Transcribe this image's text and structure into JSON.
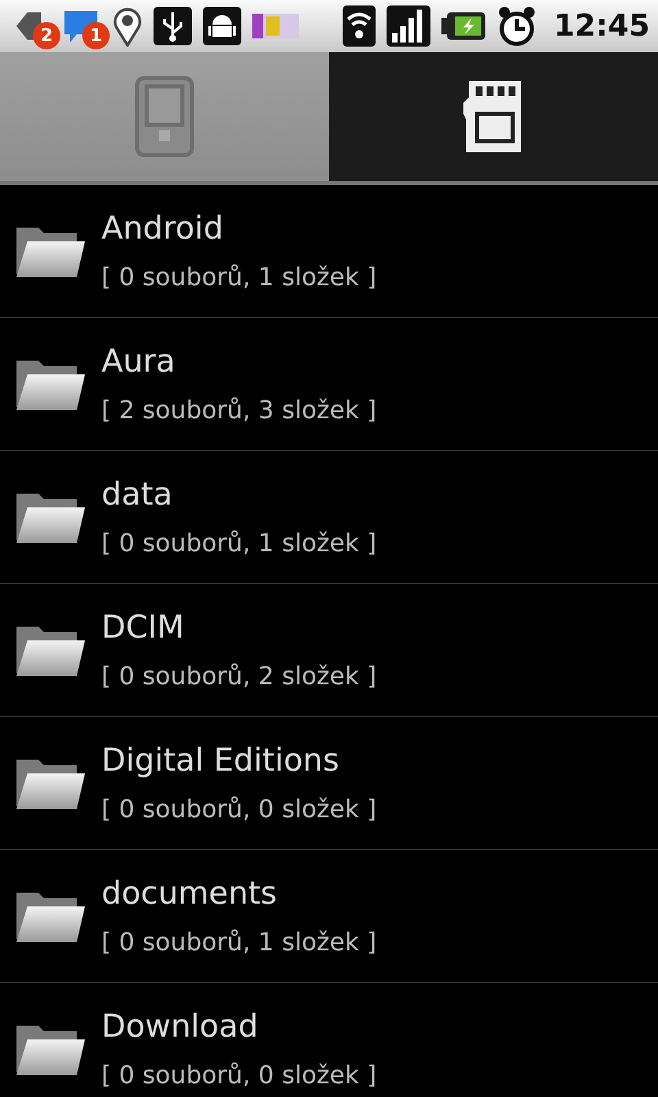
{
  "status_bar": {
    "badges": [
      "2",
      "1"
    ],
    "time": "12:45"
  },
  "tabs": [
    {
      "kind": "phone",
      "selected": true
    },
    {
      "kind": "sdcard",
      "selected": false
    }
  ],
  "folders": [
    {
      "name": "Android",
      "info": "[ 0 souborů, 1 složek ]"
    },
    {
      "name": "Aura",
      "info": "[ 2 souborů, 3 složek ]"
    },
    {
      "name": "data",
      "info": "[ 0 souborů, 1 složek ]"
    },
    {
      "name": "DCIM",
      "info": "[ 0 souborů, 2 složek ]"
    },
    {
      "name": "Digital Editions",
      "info": "[ 0 souborů, 0 složek ]"
    },
    {
      "name": "documents",
      "info": "[ 0 souborů, 1 složek ]"
    },
    {
      "name": "Download",
      "info": "[ 0 souborů, 0 složek ]"
    }
  ]
}
